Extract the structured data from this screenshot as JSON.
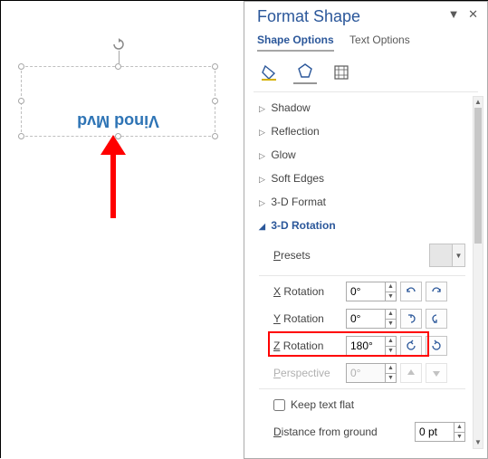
{
  "canvas": {
    "textbox_text": "Vinod Mvd"
  },
  "panel": {
    "title": "Format Shape",
    "tabs": {
      "shape": "Shape Options",
      "text": "Text Options"
    },
    "sections": {
      "shadow": "Shadow",
      "reflection": "Reflection",
      "glow": "Glow",
      "soft_edges": "Soft Edges",
      "format3d": "3-D Format",
      "rotation3d": "3-D Rotation"
    },
    "rotation": {
      "presets_label": "Presets",
      "xrot_label": "X Rotation",
      "yrot_label": "Y Rotation",
      "zrot_label": "Z Rotation",
      "perspective_label": "Perspective",
      "xrot_value": "0°",
      "yrot_value": "0°",
      "zrot_value": "180°",
      "perspective_value": "0°",
      "keep_flat_label": "Keep text flat",
      "distance_label": "Distance from ground",
      "distance_value": "0 pt"
    }
  }
}
